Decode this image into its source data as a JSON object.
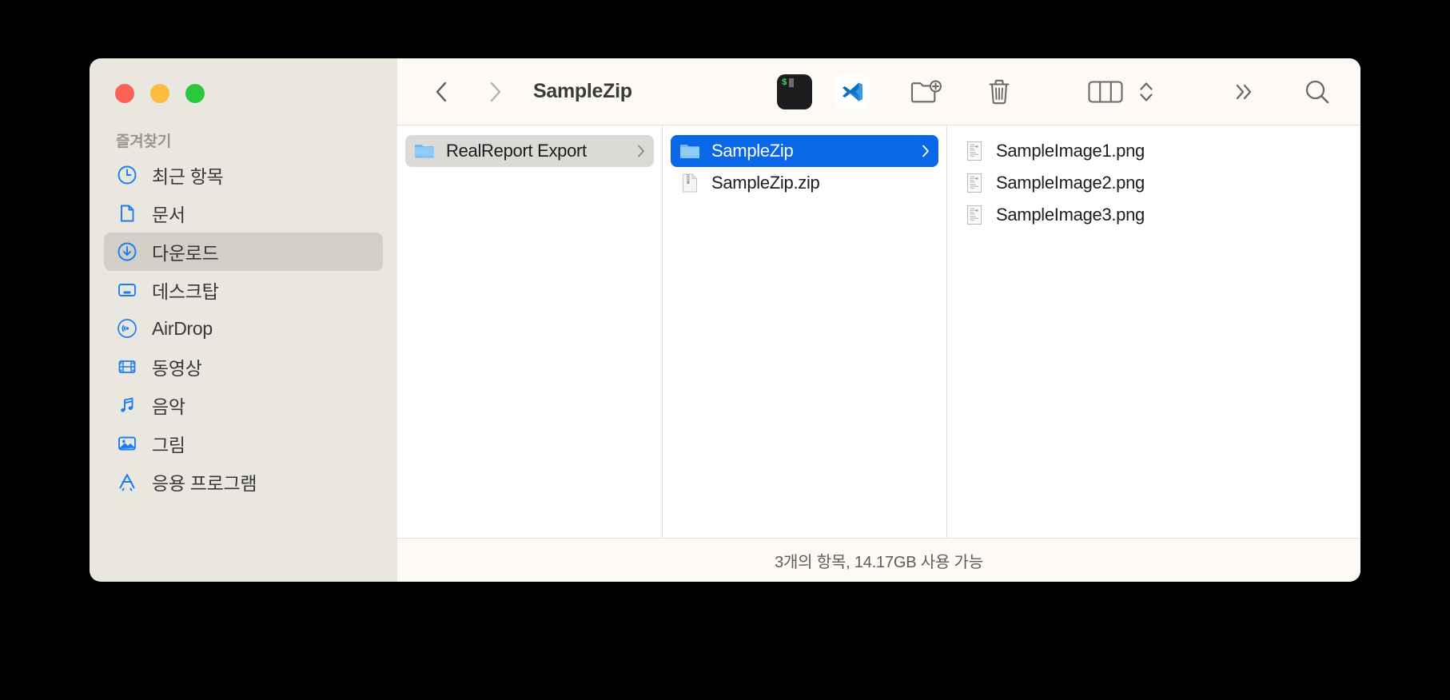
{
  "window": {
    "title": "SampleZip",
    "traffic_lights": [
      {
        "name": "close",
        "color": "#fc6158"
      },
      {
        "name": "minimize",
        "color": "#fcbc40"
      },
      {
        "name": "zoom",
        "color": "#2dc73f"
      }
    ]
  },
  "toolbar": {
    "back_icon": "chevron-left-icon",
    "forward_icon": "chevron-right-icon",
    "items": [
      {
        "name": "terminal-app-icon",
        "label": "Terminal",
        "prompt": "$"
      },
      {
        "name": "vscode-app-icon",
        "label": "Visual Studio Code"
      },
      {
        "name": "new-folder-icon",
        "label": "New Folder"
      },
      {
        "name": "trash-icon",
        "label": "Trash"
      },
      {
        "name": "column-view-icon",
        "label": "Column View"
      },
      {
        "name": "view-options-chevrons-icon",
        "label": "View Options"
      },
      {
        "name": "more-icon",
        "label": "More"
      },
      {
        "name": "search-icon",
        "label": "Search"
      }
    ]
  },
  "sidebar": {
    "section_title": "즐겨찾기",
    "items": [
      {
        "label": "최근 항목",
        "icon": "clock-icon",
        "selected": false
      },
      {
        "label": "문서",
        "icon": "document-icon",
        "selected": false
      },
      {
        "label": "다운로드",
        "icon": "download-circle-icon",
        "selected": true
      },
      {
        "label": "데스크탑",
        "icon": "desktop-icon",
        "selected": false
      },
      {
        "label": "AirDrop",
        "icon": "airdrop-icon",
        "selected": false
      },
      {
        "label": "동영상",
        "icon": "film-icon",
        "selected": false
      },
      {
        "label": "음악",
        "icon": "music-note-icon",
        "selected": false
      },
      {
        "label": "그림",
        "icon": "picture-icon",
        "selected": false
      },
      {
        "label": "응용 프로그램",
        "icon": "applications-icon",
        "selected": false
      }
    ]
  },
  "columns": [
    {
      "name": "column-1",
      "rows": [
        {
          "label": "RealReport Export",
          "icon": "folder-icon",
          "selection": "gray",
          "chevron": true
        }
      ]
    },
    {
      "name": "column-2",
      "rows": [
        {
          "label": "SampleZip",
          "icon": "folder-icon",
          "selection": "blue",
          "chevron": true
        },
        {
          "label": "SampleZip.zip",
          "icon": "zip-file-icon",
          "selection": "none",
          "chevron": false
        }
      ]
    },
    {
      "name": "column-3",
      "rows": [
        {
          "label": "SampleImage1.png",
          "icon": "image-file-icon",
          "selection": "none",
          "chevron": false
        },
        {
          "label": "SampleImage2.png",
          "icon": "image-file-icon",
          "selection": "none",
          "chevron": false
        },
        {
          "label": "SampleImage3.png",
          "icon": "image-file-icon",
          "selection": "none",
          "chevron": false
        }
      ]
    }
  ],
  "status_bar": {
    "text": "3개의 항목, 14.17GB 사용 가능"
  },
  "colors": {
    "accent_blue": "#0a68e8",
    "sidebar_bg": "#eae6e0",
    "toolbar_bg": "#fdfaf5",
    "sidebar_selected": "#d2cec8",
    "icon_blue": "#1a7ef0"
  }
}
